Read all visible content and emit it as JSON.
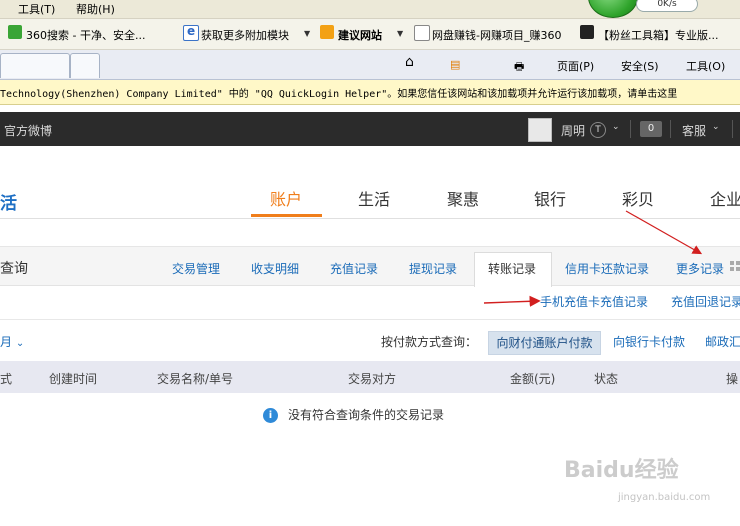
{
  "browser": {
    "menu": [
      "工具(T)",
      "帮助(H)"
    ],
    "speed_badge": "0K/s",
    "links": [
      {
        "label": "360搜索 - 干净、安全...",
        "icon": "search-360-icon"
      },
      {
        "label": "获取更多附加模块",
        "icon": "ie-icon"
      },
      {
        "label": "建议网站",
        "icon": "bing-icon"
      },
      {
        "label": "网盘赚钱-网赚项目_赚360",
        "icon": "page-icon"
      },
      {
        "label": "【粉丝工具箱】专业版...",
        "icon": "tools-icon"
      }
    ],
    "commands": {
      "page": "页面(P)",
      "safety": "安全(S)",
      "tools": "工具(O)"
    },
    "infobar": "Technology(Shenzhen) Company Limited\" 中的 \"QQ QuickLogin Helper\"。如果您信任该网站和该加载项并允许运行该加载项，请单击这里"
  },
  "site": {
    "weibo": "官方微博",
    "user_name": "周明",
    "message_count": "0",
    "service": "客服",
    "logo_fragment": "活",
    "nav": [
      "账户",
      "生活",
      "聚惠",
      "银行",
      "彩贝",
      "企业"
    ],
    "active_nav": "账户"
  },
  "records": {
    "section_title": "查询",
    "tabs": [
      "交易管理",
      "收支明细",
      "充值记录",
      "提现记录",
      "转账记录",
      "信用卡还款记录",
      "更多记录"
    ],
    "active_tab": "转账记录",
    "sub_links": [
      "手机充值卡充值记录",
      "充值回退记录"
    ],
    "month_filter": "月",
    "pay_filter_label": "按付款方式查询：",
    "pay_options": [
      "向财付通账户付款",
      "向银行卡付款",
      "邮政汇"
    ],
    "columns": [
      "式",
      "创建时间",
      "交易名称/单号",
      "交易对方",
      "金额(元)",
      "状态",
      "操"
    ],
    "empty_message": "没有符合查询条件的交易记录"
  },
  "watermark": {
    "main": "Baidu经验",
    "sub": "jingyan.baidu.com"
  },
  "colors": {
    "accent": "#f07e1b",
    "link": "#1a6bb8",
    "annotation": "#d21f1f"
  }
}
